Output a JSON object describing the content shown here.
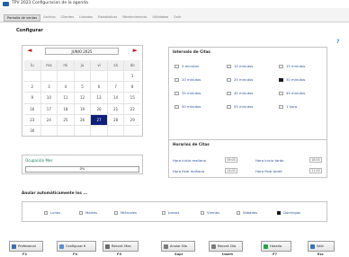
{
  "window": {
    "title": "TPV 2023 Configuracion de la agenda"
  },
  "menu": [
    {
      "label": "Pantalla de ventas",
      "active": true
    },
    {
      "label": "Archivo",
      "active": false
    },
    {
      "label": "Clientes",
      "active": false
    },
    {
      "label": "Listados",
      "active": false
    },
    {
      "label": "Estadisticas",
      "active": false
    },
    {
      "label": "Mantenimiento",
      "active": false
    },
    {
      "label": "Utilidades",
      "active": false
    },
    {
      "label": "Salir",
      "active": false
    }
  ],
  "page": {
    "heading": "Configurar",
    "help": "?"
  },
  "calendar": {
    "prev": "◄",
    "next": "►",
    "month_label": "JUNIO 2025",
    "weekdays": [
      "lu",
      "ma",
      "mi",
      "ju",
      "vi",
      "sá",
      "do"
    ],
    "days": [
      "",
      "",
      "",
      "",
      "",
      "",
      "1",
      "2",
      "3",
      "4",
      "5",
      "6",
      "7",
      "8",
      "9",
      "10",
      "11",
      "12",
      "13",
      "14",
      "15",
      "16",
      "17",
      "18",
      "19",
      "20",
      "21",
      "22",
      "23",
      "24",
      "25",
      "26",
      "27",
      "28",
      "29",
      "30",
      "",
      "",
      "",
      "",
      "",
      ""
    ],
    "selected_day": "27"
  },
  "ocupacion": {
    "label": "Ocupación Mes",
    "value": "0%",
    "fraction": 0
  },
  "intervalos": {
    "title": "Intervalo de Citas",
    "options": [
      {
        "label": "5 minutos",
        "checked": false
      },
      {
        "label": "10 minutos",
        "checked": false
      },
      {
        "label": "15 minutos",
        "checked": false
      },
      {
        "label": "20 minutos",
        "checked": false
      },
      {
        "label": "25 minutos",
        "checked": false
      },
      {
        "label": "30 minutos",
        "checked": true
      },
      {
        "label": "35 minutos",
        "checked": false
      },
      {
        "label": "40 minutos",
        "checked": false
      },
      {
        "label": "45 minutos",
        "checked": false
      },
      {
        "label": "50 minutos",
        "checked": false
      },
      {
        "label": "55 minutos",
        "checked": false
      },
      {
        "label": "1 hora",
        "checked": false
      }
    ]
  },
  "horarios": {
    "title": "Horarios de Citas",
    "inicio_manana_label": "Hora inicio mañana",
    "inicio_manana_value": "09:00",
    "inicio_tarde_label": "Hora inicio tarde",
    "inicio_tarde_value": "16:00",
    "final_manana_label": "Hora final mañana",
    "final_manana_value": "14:00",
    "final_tarde_label": "Hora final tarde",
    "final_tarde_value": "21:00"
  },
  "anular": {
    "title": "Anular automáticamente los ...",
    "days": [
      {
        "label": "Lunes",
        "checked": false
      },
      {
        "label": "Martes",
        "checked": false
      },
      {
        "label": "Miércoles",
        "checked": false
      },
      {
        "label": "Jueves",
        "checked": false
      },
      {
        "label": "Viernes",
        "checked": false
      },
      {
        "label": "Sábados",
        "checked": false
      },
      {
        "label": "Domingos",
        "checked": true
      }
    ]
  },
  "footer": [
    {
      "label": "Profesional",
      "key": "F2",
      "color": "#3a6fb5"
    },
    {
      "label": "Configurar ▾",
      "key": "F4",
      "color": "#5b8fd0"
    },
    {
      "label": "Reconf. Mes",
      "key": "F5",
      "color": "#6a6a6a"
    },
    {
      "label": "Anular Día",
      "key": "Supr",
      "color": "#7a7a7a"
    },
    {
      "label": "Reconf. Día",
      "key": "Insert",
      "color": "#7a7a7a"
    },
    {
      "label": "Horario",
      "key": "F7",
      "color": "#2e9e4a"
    },
    {
      "label": "Salir",
      "key": "Esc",
      "color": "#3a6fb5"
    }
  ]
}
